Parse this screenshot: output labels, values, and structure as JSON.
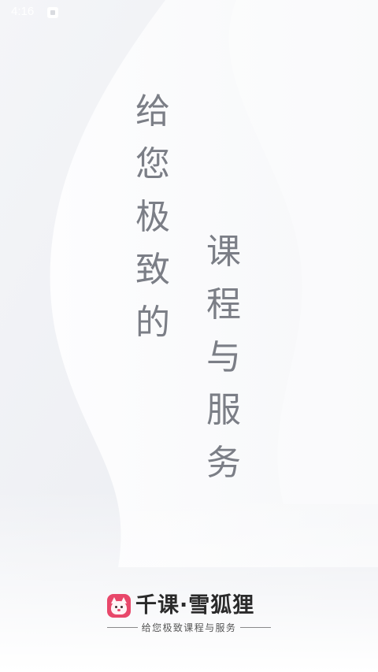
{
  "status_bar": {
    "time": "4:16"
  },
  "headline": {
    "left_column": [
      "给",
      "您",
      "极",
      "致",
      "的"
    ],
    "right_column": [
      "课",
      "程",
      "与",
      "服",
      "务"
    ]
  },
  "brand": {
    "logo_text": "千课·雪狐狸",
    "slogan": "给您极致课程与服务"
  },
  "colors": {
    "background": "#eef0f4",
    "headline_text": "#7b7e86",
    "logo_accent": "#e8476a"
  }
}
